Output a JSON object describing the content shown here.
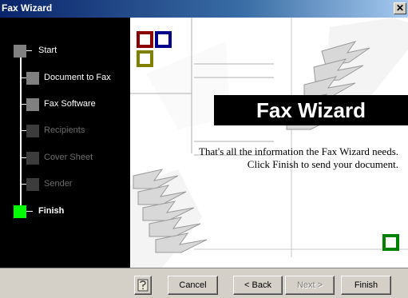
{
  "window": {
    "title": "Fax Wizard",
    "close_glyph": "✕"
  },
  "steps": [
    {
      "label": "Start",
      "state": "done"
    },
    {
      "label": "Document to Fax",
      "state": "done"
    },
    {
      "label": "Fax Software",
      "state": "done"
    },
    {
      "label": "Recipients",
      "state": "disabled"
    },
    {
      "label": "Cover Sheet",
      "state": "disabled"
    },
    {
      "label": "Sender",
      "state": "disabled"
    },
    {
      "label": "Finish",
      "state": "current"
    }
  ],
  "content": {
    "banner": "Fax Wizard",
    "message_line1": "That's all the information the Fax Wizard needs.",
    "message_line2": "Click Finish to send your document."
  },
  "buttons": {
    "help_icon": "help-icon",
    "cancel": "Cancel",
    "back": "< Back",
    "next": "Next >",
    "finish": "Finish"
  },
  "colors": {
    "step_done": "#808080",
    "step_disabled": "#3c3c3c",
    "step_current": "#00ff00",
    "deco_red": "#8b0000",
    "deco_blue": "#00008b",
    "deco_olive": "#808000",
    "deco_green": "#008000"
  }
}
